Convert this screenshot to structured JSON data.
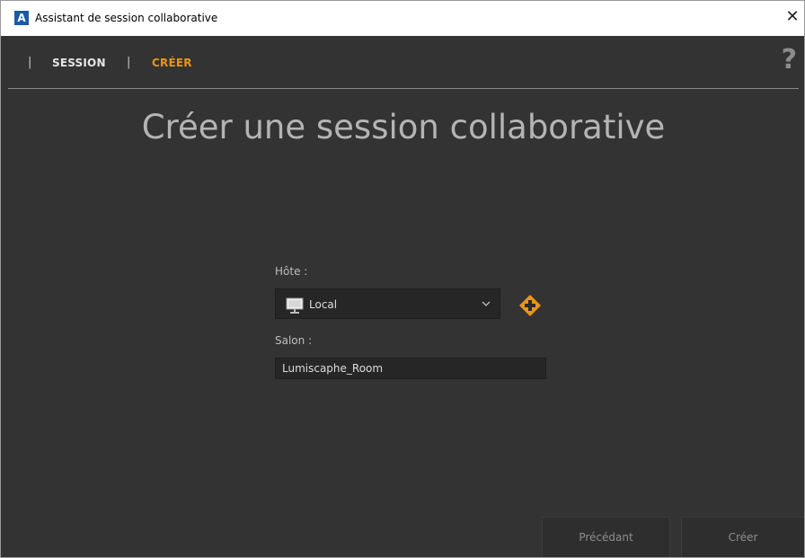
{
  "window": {
    "title": "Assistant de session collaborative",
    "app_icon_letter": "A",
    "close_glyph": "✕"
  },
  "tabs": {
    "separator": "|",
    "items": [
      {
        "label": "SESSION",
        "active": false
      },
      {
        "label": "CRÉER",
        "active": true
      }
    ],
    "help_glyph": "?"
  },
  "page": {
    "title": "Créer une session collaborative"
  },
  "form": {
    "host_label": "Hôte :",
    "host_value": "Local",
    "room_label": "Salon :",
    "room_value": "Lumiscaphe_Room"
  },
  "footer": {
    "previous_label": "Précédant",
    "create_label": "Créer"
  },
  "colors": {
    "background": "#333333",
    "accent": "#e8951a",
    "field_background": "#262626"
  },
  "icons": [
    "monitor-icon",
    "chevron-down-icon",
    "add-plus-icon",
    "help-icon",
    "close-icon"
  ]
}
